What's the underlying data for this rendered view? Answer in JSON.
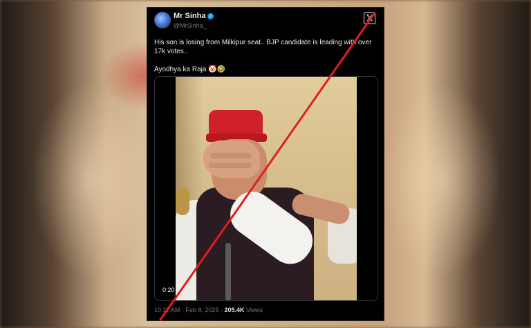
{
  "tweet": {
    "display_name": "Mr Sinha",
    "handle": "@MrSinha_",
    "text_line1": "His son is losing from Milkipur seat.. BJP candidate is leading with over 17k votes..",
    "text_line2": "Ayodhya ka Raja 🤡🤣",
    "video_timecode": "0:20",
    "time": "10:11 AM",
    "separator": "·",
    "date": "Feb 8, 2025",
    "views_count": "205.4K",
    "views_label": "Views"
  },
  "icons": {
    "verified": "verified-badge-icon",
    "platform": "x-logo-icon"
  },
  "colors": {
    "strike_line": "#e01e1e",
    "verified_blue": "#1d9bf0",
    "background": "#000000",
    "secondary_text": "#71767b"
  }
}
